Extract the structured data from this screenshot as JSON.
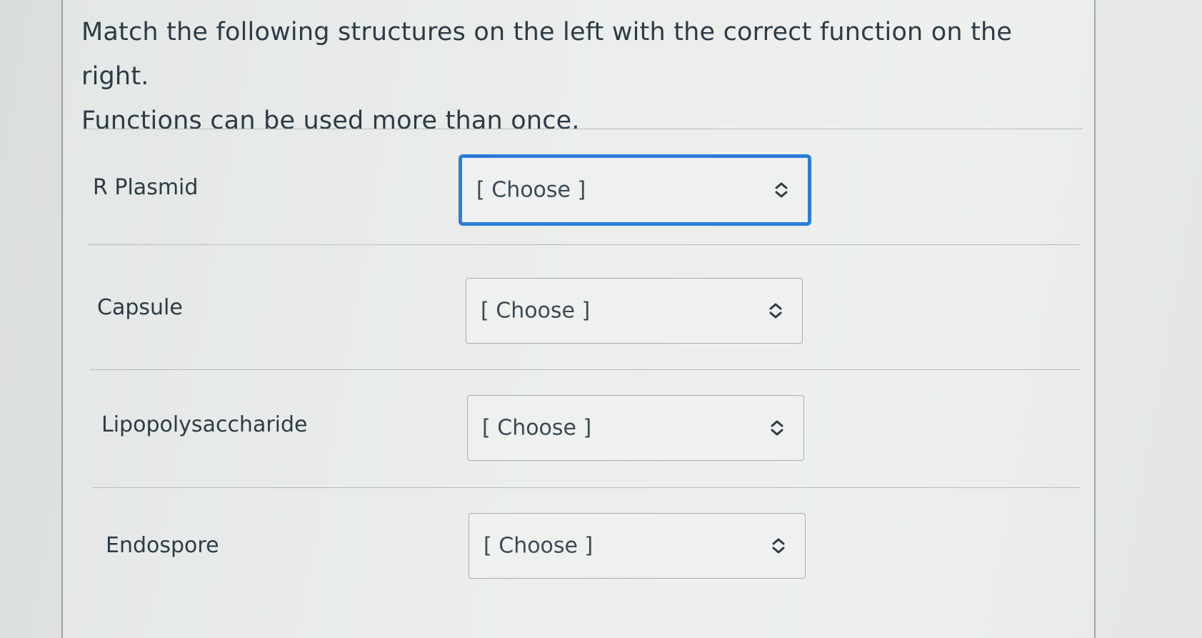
{
  "question": {
    "prompt_line1": "Match the following structures on the left with the correct function on the right.",
    "prompt_line2": "Functions can be used more than once."
  },
  "matches": [
    {
      "structure": "R Plasmid",
      "selected": "[ Choose ]",
      "focused": true,
      "icon": "up-down-chevron-icon"
    },
    {
      "structure": "Capsule",
      "selected": "[ Choose ]",
      "focused": false,
      "icon": "up-down-chevron-icon"
    },
    {
      "structure": "Lipopolysaccharide",
      "selected": "[ Choose ]",
      "focused": false,
      "icon": "up-down-chevron-icon"
    },
    {
      "structure": "Endospore",
      "selected": "[ Choose ]",
      "focused": false,
      "icon": "up-down-chevron-icon"
    }
  ],
  "colors": {
    "text": "#2d3b45",
    "focus_border": "#2a7ed6",
    "select_border": "#a9aeae"
  }
}
